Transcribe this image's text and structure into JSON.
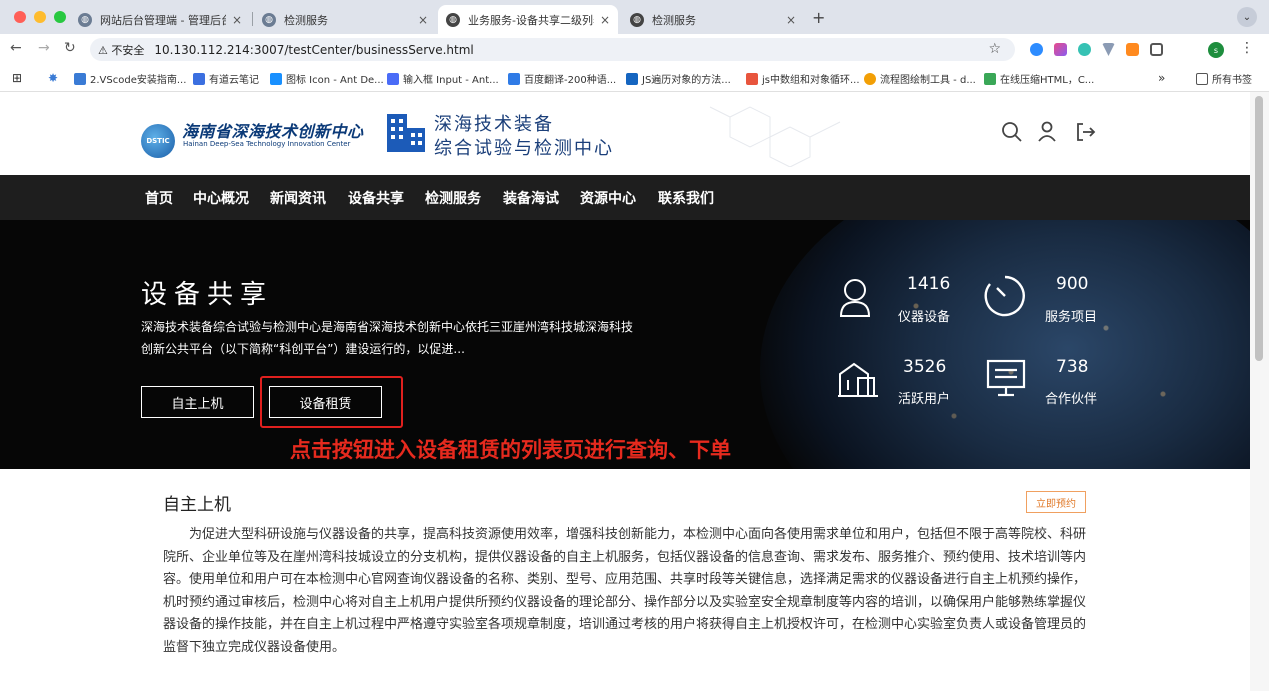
{
  "browser": {
    "tabs": [
      {
        "title": "网站后台管理端 - 管理后台",
        "active": false
      },
      {
        "title": "检测服务",
        "active": false
      },
      {
        "title": "业务服务-设备共享二级列表页",
        "active": true
      },
      {
        "title": "检测服务",
        "active": false
      }
    ],
    "new_tab_label": "+",
    "security_label": "⚠ 不安全",
    "url": "10.130.112.214:3007/testCenter/businessServe.html",
    "profile_initial": "s"
  },
  "bookmarks": {
    "items": [
      {
        "label": "2.VScode安装指南...",
        "color": "#3a7bd5"
      },
      {
        "label": "有道云笔记",
        "color": "#3b6fe0"
      },
      {
        "label": "图标 Icon - Ant De...",
        "color": "#1890ff"
      },
      {
        "label": "输入框 Input - Ant...",
        "color": "#4a6cf7"
      },
      {
        "label": "百度翻译-200种语...",
        "color": "#2f7be6"
      },
      {
        "label": "JS遍历对象的方法...",
        "color": "#1565c0"
      },
      {
        "label": "js中数组和对象循环...",
        "color": "#e8553d"
      },
      {
        "label": "流程图绘制工具 - d...",
        "color": "#f29f05"
      },
      {
        "label": "在线压缩HTML，C...",
        "color": "#3aa757"
      }
    ],
    "more_label": "»",
    "all_bookmarks_label": "所有书签"
  },
  "header": {
    "emblem_text": "DSTIC",
    "logo_cn": "海南省深海技术创新中心",
    "logo_en": "Hainan Deep-Sea Technology Innovation Center",
    "subtitle_line1": "深海技术装备",
    "subtitle_line2": "综合试验与检测中心"
  },
  "nav": {
    "items": [
      "首页",
      "中心概况",
      "新闻资讯",
      "设备共享",
      "检测服务",
      "装备海试",
      "资源中心",
      "联系我们"
    ]
  },
  "banner": {
    "title": "设备共享",
    "description": "深海技术装备综合试验与检测中心是海南省深海技术创新中心依托三亚崖州湾科技城深海科技创新公共平台（以下简称“科创平台”）建设运行的，以促进...",
    "buttons": [
      "自主上机",
      "设备租赁"
    ],
    "annotation": "点击按钮进入设备租赁的列表页进行查询、下单",
    "stats": [
      {
        "value": "1416",
        "label": "仪器设备"
      },
      {
        "value": "900",
        "label": "服务项目"
      },
      {
        "value": "3526",
        "label": "活跃用户"
      },
      {
        "value": "738",
        "label": "合作伙伴"
      }
    ]
  },
  "section": {
    "title": "自主上机",
    "reserve_label": "立即预约",
    "body": "为促进大型科研设施与仪器设备的共享，提高科技资源使用效率，增强科技创新能力，本检测中心面向各使用需求单位和用户，包括但不限于高等院校、科研院所、企业单位等及在崖州湾科技城设立的分支机构，提供仪器设备的自主上机服务，包括仪器设备的信息查询、需求发布、服务推介、预约使用、技术培训等内容。使用单位和用户可在本检测中心官网查询仪器设备的名称、类别、型号、应用范围、共享时段等关键信息，选择满足需求的仪器设备进行自主上机预约操作，机时预约通过审核后，检测中心将对自主上机用户提供所预约仪器设备的理论部分、操作部分以及实验室安全规章制度等内容的培训，以确保用户能够熟练掌握仪器设备的操作技能，并在自主上机过程中严格遵守实验室各项规章制度，培训通过考核的用户将获得自主上机授权许可，在检测中心实验室负责人或设备管理员的监督下独立完成仪器设备使用。"
  },
  "colors": {
    "nav_bg": "#1e1e1e",
    "banner_bg": "#060606",
    "annotation_red": "#e62a1e",
    "logo_blue": "#0b3a78",
    "reserve_orange": "#e07a2a"
  }
}
